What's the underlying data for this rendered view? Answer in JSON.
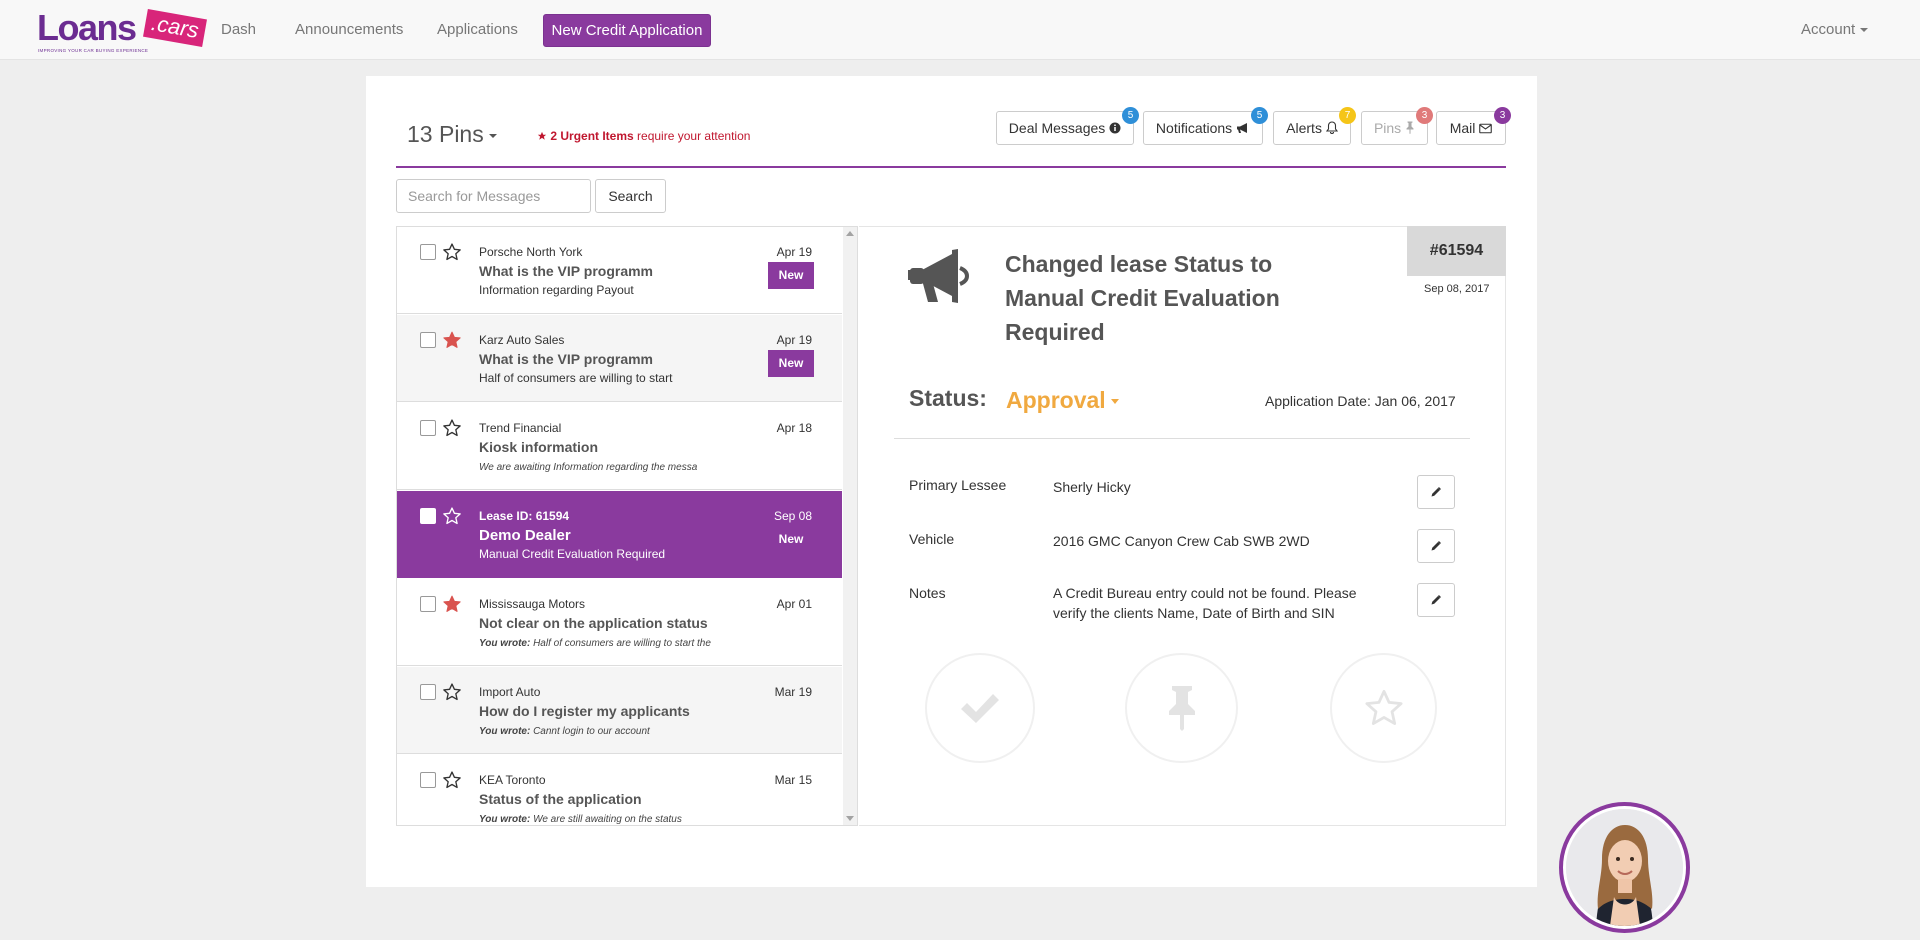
{
  "nav": {
    "logo_word": "Loans",
    "logo_tag": ".cars",
    "logo_tagline": "IMPROVING YOUR CAR BUYING EXPERIENCE",
    "links": [
      "Dash",
      "Announcements",
      "Applications"
    ],
    "new_application": "New Credit Application",
    "account": "Account"
  },
  "header": {
    "pins_title": "13 Pins",
    "urgent_count": "2 Urgent Items",
    "urgent_suffix": " require your attention",
    "buttons": [
      {
        "label": "Deal Messages",
        "icon": "info-circle-icon",
        "badge": "5",
        "badge_color": "#2f8fd8"
      },
      {
        "label": "Notifications",
        "icon": "bullhorn-icon",
        "badge": "5",
        "badge_color": "#2f8fd8"
      },
      {
        "label": "Alerts",
        "icon": "bell-icon",
        "badge": "7",
        "badge_color": "#f5c518"
      },
      {
        "label": "Pins",
        "icon": "pin-icon",
        "badge": "3",
        "badge_color": "#e07a7a"
      },
      {
        "label": "Mail",
        "icon": "envelope-icon",
        "badge": "3",
        "badge_color": "#8a3a9e"
      }
    ]
  },
  "search": {
    "placeholder": "Search for Messages",
    "button": "Search"
  },
  "messages": [
    {
      "sender": "Porsche North York",
      "subject": "What is the VIP programm",
      "preview": "Information regarding Payout",
      "date": "Apr 19",
      "badge": "New",
      "starred": false
    },
    {
      "sender": "Karz Auto Sales",
      "subject": "What is the VIP programm",
      "preview": "Half of consumers are willing to start",
      "date": "Apr 19",
      "badge": "New",
      "starred": true
    },
    {
      "sender": "Trend Financial",
      "subject": "Kiosk information",
      "preview": "We are awaiting Information regarding the messa",
      "date": "Apr 18",
      "badge": "",
      "starred": false
    },
    {
      "sender": "Lease ID: 61594",
      "subject": "Demo Dealer",
      "preview": "Manual Credit Evaluation Required",
      "date": "Sep 08",
      "badge": "New",
      "starred": false,
      "selected": true
    },
    {
      "sender": "Mississauga Motors",
      "subject": "Not clear on the application status",
      "preview_prefix": "You wrote:",
      "preview": " Half of consumers are willing to start the",
      "date": "Apr 01",
      "badge": "",
      "starred": true
    },
    {
      "sender": "Import Auto",
      "subject": "How do I register my applicants",
      "preview_prefix": "You wrote:",
      "preview": " Cannt login to our account",
      "date": "Mar 19",
      "badge": "",
      "starred": false
    },
    {
      "sender": "KEA Toronto",
      "subject": "Status of the application",
      "preview_prefix": "You wrote:",
      "preview": " We are still awaiting on the status",
      "date": "Mar 15",
      "badge": "",
      "starred": false
    }
  ],
  "detail": {
    "title": "Changed lease Status to Manual Credit Evaluation Required",
    "id": "#61594",
    "id_date": "Sep 08, 2017",
    "status_label": "Status:",
    "status_value": "Approval",
    "application_date": "Application Date: Jan 06, 2017",
    "rows": [
      {
        "label": "Primary Lessee",
        "value": "Sherly Hicky"
      },
      {
        "label": "Vehicle",
        "value": "2016 GMC Canyon Crew Cab SWB 2WD"
      },
      {
        "label": "Notes",
        "value": "A Credit Bureau entry could not be found. Please verify the clients Name, Date of Birth and SIN"
      }
    ]
  },
  "colors": {
    "brand": "#8a3a9e",
    "status": "#f0a940",
    "urgent": "#c0172f",
    "star_active": "#d9534f"
  }
}
